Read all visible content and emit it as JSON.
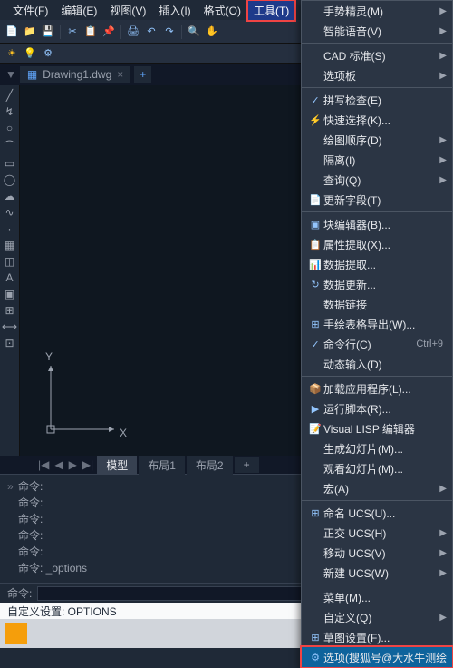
{
  "menubar": {
    "items": [
      "文件(F)",
      "编辑(E)",
      "视图(V)",
      "插入(I)",
      "格式(O)",
      "工具(T)"
    ],
    "highlighted_index": 5
  },
  "document": {
    "tab_title": "Drawing1.dwg",
    "close_glyph": "×",
    "plus_glyph": "+"
  },
  "axis": {
    "x": "X",
    "y": "Y"
  },
  "layout_tabs": {
    "nav": [
      "|◀",
      "◀",
      "▶",
      "▶|"
    ],
    "tabs": [
      "模型",
      "布局1",
      "布局2"
    ],
    "plus": "+",
    "active_index": 0
  },
  "cmdlog": {
    "lines": [
      "命令:",
      "命令:",
      "命令:",
      "命令:",
      "命令:",
      "命令: _options"
    ],
    "gutter": "»"
  },
  "cmdinput": {
    "label": "命令:",
    "value": ""
  },
  "statusbar": {
    "text": "自定义设置: OPTIONS"
  },
  "menu": {
    "items": [
      {
        "text": "手势精灵(M)",
        "icon": "",
        "arrow": true
      },
      {
        "text": "智能语音(V)",
        "icon": "",
        "arrow": true
      },
      {
        "sep": true
      },
      {
        "text": "CAD 标准(S)",
        "icon": "",
        "arrow": true
      },
      {
        "text": "选项板",
        "icon": "",
        "arrow": true
      },
      {
        "sep": true
      },
      {
        "text": "拼写检查(E)",
        "icon": "✓"
      },
      {
        "text": "快速选择(K)...",
        "icon": "⚡"
      },
      {
        "text": "绘图顺序(D)",
        "icon": "",
        "arrow": true
      },
      {
        "text": "隔离(I)",
        "icon": "",
        "arrow": true
      },
      {
        "text": "查询(Q)",
        "icon": "",
        "arrow": true
      },
      {
        "text": "更新字段(T)",
        "icon": "📄"
      },
      {
        "sep": true
      },
      {
        "text": "块编辑器(B)...",
        "icon": "▣"
      },
      {
        "text": "属性提取(X)...",
        "icon": "📋"
      },
      {
        "text": "数据提取...",
        "icon": "📊"
      },
      {
        "text": "数据更新...",
        "icon": "↻"
      },
      {
        "text": "数据链接",
        "icon": ""
      },
      {
        "text": "手绘表格导出(W)...",
        "icon": "⊞"
      },
      {
        "text": "命令行(C)",
        "icon": "✓",
        "shortcut": "Ctrl+9"
      },
      {
        "text": "动态输入(D)",
        "icon": ""
      },
      {
        "sep": true
      },
      {
        "text": "加载应用程序(L)...",
        "icon": "📦"
      },
      {
        "text": "运行脚本(R)...",
        "icon": "▶"
      },
      {
        "text": "Visual LISP 编辑器",
        "icon": "📝"
      },
      {
        "text": "生成幻灯片(M)...",
        "icon": ""
      },
      {
        "text": "观看幻灯片(M)...",
        "icon": ""
      },
      {
        "text": "宏(A)",
        "icon": "",
        "arrow": true
      },
      {
        "sep": true
      },
      {
        "text": "命名 UCS(U)...",
        "icon": "⊞"
      },
      {
        "text": "正交 UCS(H)",
        "icon": "",
        "arrow": true
      },
      {
        "text": "移动 UCS(V)",
        "icon": "",
        "arrow": true
      },
      {
        "text": "新建 UCS(W)",
        "icon": "",
        "arrow": true
      },
      {
        "sep": true
      },
      {
        "text": "菜单(M)...",
        "icon": ""
      },
      {
        "text": "自定义(Q)",
        "icon": "",
        "arrow": true
      },
      {
        "text": "草图设置(F)...",
        "icon": "⊞"
      },
      {
        "text": "选项(搜狐号@大水牛测绘",
        "icon": "⚙",
        "highlight": true
      }
    ]
  }
}
